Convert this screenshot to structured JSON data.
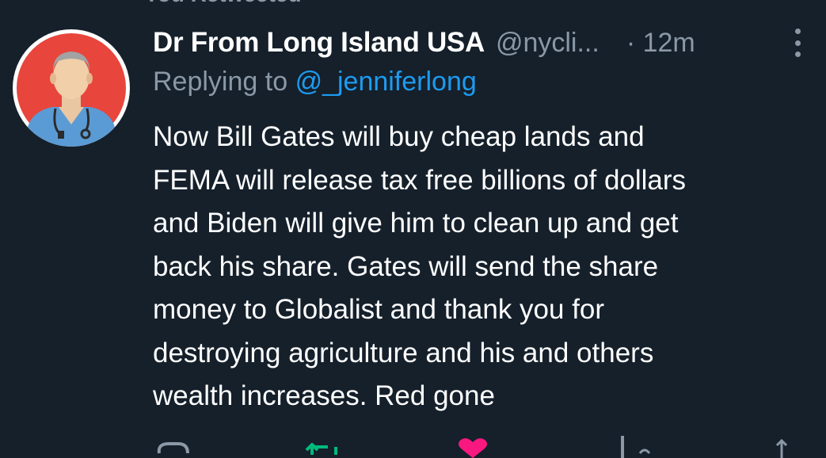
{
  "retweet_context": {
    "label": "You Retweeted",
    "icon": "retweet-icon"
  },
  "author": {
    "display_name": "Dr From Long Island USA",
    "handle": "@nycli...",
    "separator": "·",
    "time": "12m",
    "avatar_icon": "doctor-avatar-icon",
    "avatar_bg_color": "#e8453c"
  },
  "replying": {
    "prefix": "Replying to",
    "mention": "@_jenniferlong"
  },
  "tweet": {
    "lines": [
      "Now Bill Gates will buy cheap lands and",
      "FEMA will release tax free billions of dollars",
      "and Biden will give him to clean up and get",
      "back his share. Gates will send the share",
      "money to Globalist and thank you for",
      "destroying agriculture and his and others",
      "wealth increases. Red gone"
    ]
  },
  "actions": {
    "reply_icon": "reply-icon",
    "retweet_icon": "retweet-icon",
    "retweet_color": "#00ba7c",
    "like_icon": "heart-icon",
    "like_color": "#f91880",
    "views_icon": "views-icon",
    "share_icon": "share-icon"
  },
  "colors": {
    "background": "#15202b",
    "text": "#ffffff",
    "muted": "#8b98a5",
    "link": "#1d9bf0"
  }
}
